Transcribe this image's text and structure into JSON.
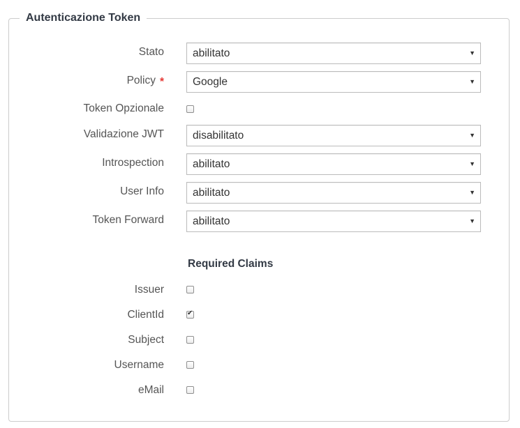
{
  "section": {
    "title": "Autenticazione Token"
  },
  "fields": {
    "stato": {
      "label": "Stato",
      "value": "abilitato"
    },
    "policy": {
      "label": "Policy",
      "required_mark": "*",
      "value": "Google"
    },
    "token_opzionale": {
      "label": "Token Opzionale",
      "checked": false
    },
    "validazione_jwt": {
      "label": "Validazione JWT",
      "value": "disabilitato"
    },
    "introspection": {
      "label": "Introspection",
      "value": "abilitato"
    },
    "user_info": {
      "label": "User Info",
      "value": "abilitato"
    },
    "token_forward": {
      "label": "Token Forward",
      "value": "abilitato"
    }
  },
  "required_claims": {
    "title": "Required Claims",
    "items": [
      {
        "label": "Issuer",
        "checked": false
      },
      {
        "label": "ClientId",
        "checked": true
      },
      {
        "label": "Subject",
        "checked": false
      },
      {
        "label": "Username",
        "checked": false
      },
      {
        "label": "eMail",
        "checked": false
      }
    ]
  },
  "icons": {
    "select_arrow": "dropdown-triangle-icon",
    "arrow_glyph": "▼"
  },
  "colors": {
    "required": "#e53935",
    "border": "#cccccc",
    "label": "#555555",
    "heading": "#333a45"
  }
}
